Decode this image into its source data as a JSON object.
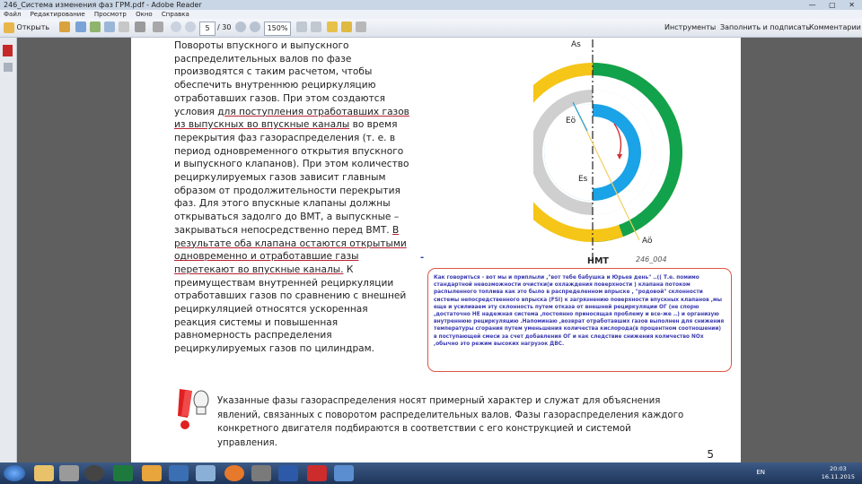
{
  "window": {
    "title": "246_Система изменения фаз ГРМ.pdf - Adobe Reader"
  },
  "menu": [
    "Файл",
    "Редактирование",
    "Просмотр",
    "Окно",
    "Справка"
  ],
  "toolbar": {
    "open_label": "Открыть",
    "page_current": "5",
    "page_total": "/ 30",
    "zoom": "150%",
    "tools": "Инструменты",
    "fill_sign": "Заполнить и подписать",
    "comments": "Комментарии"
  },
  "page": {
    "body_before": "Повороты впускного и выпускного распределительных валов по фазе производятся с таким расчетом, чтобы обеспечить внутреннюю рециркуляцию отработавших газов. При этом создаются условия ",
    "body_ul1": "для поступления отработавших газов из выпускных во впускные каналы",
    "body_mid1": " во время перекрытия фаз газораспределения (т. е. в период одновременного открытия впускного и выпускного клапанов). При этом количество рециркулируемых газов зависит главным образом от продолжительности перекрытия фаз. Для этого впускные клапаны должны открываться задолго до ВМТ, а выпускные – закрываться непосредственно перед ВМТ. ",
    "body_ul2": "В результате оба клапана остаются открытыми одновременно и отработавшие газы перетекают во впускные каналы.",
    "body_after": " К преимуществам внутренней рециркуляции отработавших газов по сравнению с внешней рециркуляцией относятся ускоренная реакция системы и повышенная равномерность распределения рециркулируемых газов по цилиндрам.",
    "note": "Указанные фазы газораспределения носят примерный характер и служат для объяснения явлений, связанных с поворотом распределительных валов. Фазы газораспределения каждого конкретного двигателя подбираются в соответствии с его конструкцией и системой управления.",
    "page_number": "5",
    "diagram": {
      "label_as": "As",
      "label_eo": "Eö",
      "label_es": "Es",
      "label_ao": "Aö",
      "label_nmt": "НМТ",
      "figure_id": "246_004",
      "dash": "-"
    },
    "comment": "Как говориться - вот мы и приплыли ,\"вот тебе бабушка и Юрьев день\" ..(( Т.е. помимо стандартной невозможности очистки(и охлаждения поверхности ) клапана  потоком распыленного   топлива  как это было в распределенном впрыске , \"родовой\" склонности системы непосредственного впрыска (FSI)  к загрязнению поверхности впускных клапанов ,мы еще и усиливаем эту склонность путем отказа  от внешней рециркуляции ОГ (не спорю ,достаточно НЕ надежная  система   ,постоянно приносящая проблему  и все-же ..) и организую внутреннюю рециркуляцию .Напоминаю ,возврат отработавших газов выполнен для снижения температуры  сгорания путем уменьшения  количества кислорода(в процентном соотношении) в поступающей смеси  за счет добавления ОГ  и как следствие снижения количество NOx ,обычно это режим высоких нагрузок ДВС."
  },
  "taskbar": {
    "lang": "EN",
    "time": "20:03",
    "date": "16.11.2015"
  },
  "colors": {
    "yellow": "#f5c518",
    "green": "#12a24b",
    "blue": "#1aa3e6",
    "gray": "#cfcfcf",
    "comment_border": "#d54a4a"
  }
}
